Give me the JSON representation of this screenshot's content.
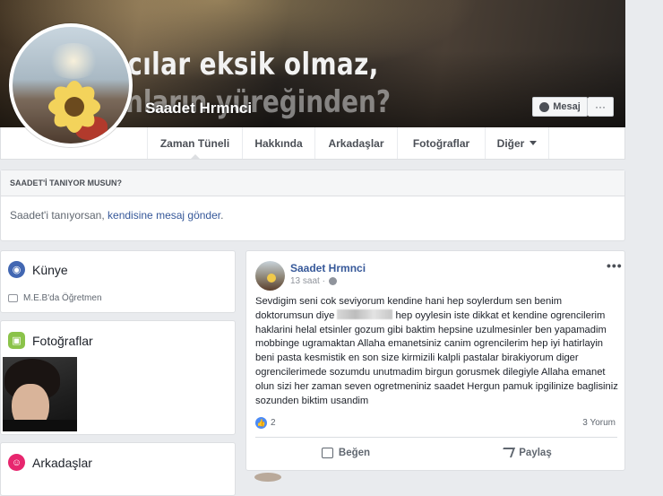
{
  "cover": {
    "line1": "ncılar eksik olmaz,",
    "line2": "nların yüreğinden?"
  },
  "profile": {
    "name": "Saadet Hrmnci"
  },
  "actions": {
    "message": "Mesaj",
    "more": "···"
  },
  "nav": {
    "tabs": [
      {
        "label": "Zaman Tüneli"
      },
      {
        "label": "Hakkında"
      },
      {
        "label": "Arkadaşlar"
      },
      {
        "label": "Fotoğraflar"
      },
      {
        "label": "Diğer"
      }
    ]
  },
  "know": {
    "header": "SAADET'İ TANIYOR MUSUN?",
    "text_before": "Saadet'i tanıyorsan, ",
    "link": "kendisine mesaj gönder",
    "text_after": "."
  },
  "sidebar": {
    "intro_title": "Künye",
    "work": "M.E.B'da Öğretmen",
    "photos_title": "Fotoğraflar",
    "friends_title": "Arkadaşlar"
  },
  "post": {
    "author": "Saadet Hrmnci",
    "time": "13 saat ·",
    "text_part1": "Sevdigim seni cok seviyorum kendine hani hep soylerdum sen benim doktorumsun diye",
    "text_part2": "hep oyylesin iste dikkat et kendine ogrencilerim haklarini helal etsinler gozum gibi baktim hepsine uzulmesinler ben yapamadim mobbinge ugramaktan Allaha emanetsiniz canim ogrencilerim hep iyi hatirlayin beni pasta kesmistik en son size kirmizili kalpli pastalar birakiyorum diger ogrencilerimede sozumdu unutmadim birgun gorusmek dilegiyle Allaha emanet olun sizi her zaman seven ogretmeniniz saadet Hergun pamuk ipgilinize baglisiniz sozunden biktim usandim",
    "likes": "2",
    "comments": "3 Yorum",
    "like_label": "Beğen",
    "share_label": "Paylaş",
    "menu": "•••"
  },
  "colors": {
    "link": "#365899",
    "bg": "#e9ebee",
    "intro_icon": "#4267b2",
    "photos_icon": "#8bc34a",
    "friends_icon": "#e7266e"
  }
}
